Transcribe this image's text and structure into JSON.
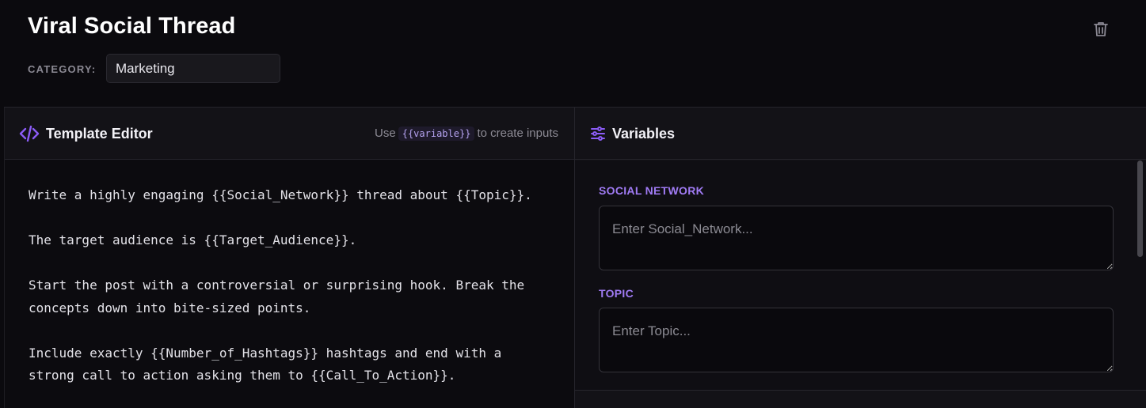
{
  "prompt": {
    "title": "Viral Social Thread",
    "category_label": "CATEGORY:",
    "category_value": "Marketing"
  },
  "editor": {
    "title": "Template Editor",
    "hint_prefix": "Use",
    "hint_code": "{{variable}}",
    "hint_suffix": "to create inputs",
    "body": "Write a highly engaging {{Social_Network}} thread about {{Topic}}.\n\nThe target audience is {{Target_Audience}}.\n\nStart the post with a controversial or surprising hook. Break the\nconcepts down into bite-sized points.\n\nInclude exactly {{Number_of_Hashtags}} hashtags and end with a\nstrong call to action asking them to {{Call_To_Action}}."
  },
  "variables": {
    "title": "Variables",
    "items": [
      {
        "label": "SOCIAL NETWORK",
        "placeholder": "Enter Social_Network..."
      },
      {
        "label": "TOPIC",
        "placeholder": "Enter Topic..."
      }
    ]
  },
  "icons": {
    "delete": "trash-icon",
    "editor": "code-icon",
    "variables": "sliders-icon"
  },
  "colors": {
    "accent": "#8b5cf6",
    "label_accent": "#a07bf4"
  }
}
